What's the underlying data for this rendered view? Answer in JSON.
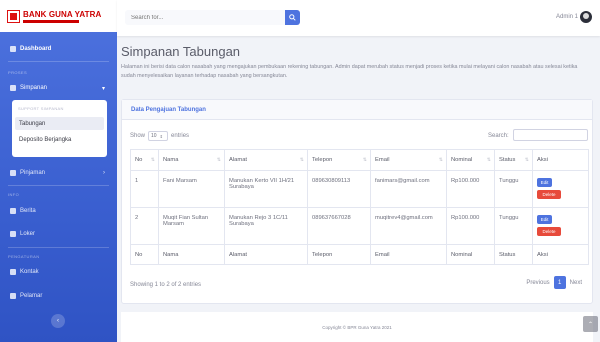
{
  "brand": {
    "title": "BANK GUNA YATRA"
  },
  "sidebar": {
    "dashboard": "Dashboard",
    "heading_proses": "PROSES",
    "simpanan": "Simpanan",
    "submenu_heading": "SUPPORT SIMPANAN",
    "submenu_items": [
      "Tabungan",
      "Deposito Berjangka"
    ],
    "pinjaman": "Pinjaman",
    "heading_info": "INFO",
    "berita": "Berita",
    "loker": "Loker",
    "heading_pengaturan": "PENGATURAN",
    "kontak": "Kontak",
    "pelamar": "Pelamar"
  },
  "topbar": {
    "search_placeholder": "Search for...",
    "user_name": "Admin 1"
  },
  "page": {
    "title": "Simpanan Tabungan",
    "description": "Halaman ini berisi data calon nasabah yang mengajukan pembukaan rekening tabungan. Admin dapat merubah status menjadi proses ketika mulai melayani calon nasabah atau selesai ketika sudah menyelesaikan layanan terhadap nasabah yang bersangkutan."
  },
  "card": {
    "header": "Data Pengajuan Tabungan",
    "show_label": "Show",
    "entries_value": "10",
    "entries_label": "entries",
    "search_label": "Search:",
    "columns": [
      "No",
      "Nama",
      "Alamat",
      "Telepon",
      "Email",
      "Nominal",
      "Status",
      "Aksi"
    ],
    "rows": [
      {
        "no": "1",
        "nama": "Fani Marsam",
        "alamat": "Manukan Kerto VII 1H/21 Surabaya",
        "telepon": "089630809113",
        "email": "fanimars@gmail.com",
        "nominal": "Rp100.000",
        "status": "Tunggu"
      },
      {
        "no": "2",
        "nama": "Muqit Fian Sultan Marsam",
        "alamat": "Manukan Rejo 3 1C/11 Surabaya",
        "telepon": "089637667028",
        "email": "muqitrev4@gmail.com",
        "nominal": "Rp100.000",
        "status": "Tunggu"
      }
    ],
    "edit_label": "Edit",
    "delete_label": "Delete",
    "showing": "Showing 1 to 2 of 2 entries",
    "prev_label": "Previous",
    "current_page": "1",
    "next_label": "Next"
  },
  "footer": {
    "text": "Copyright © BPR Guna Yatra 2021"
  },
  "colors": {
    "primary": "#4e73df",
    "danger": "#e74a3b"
  }
}
